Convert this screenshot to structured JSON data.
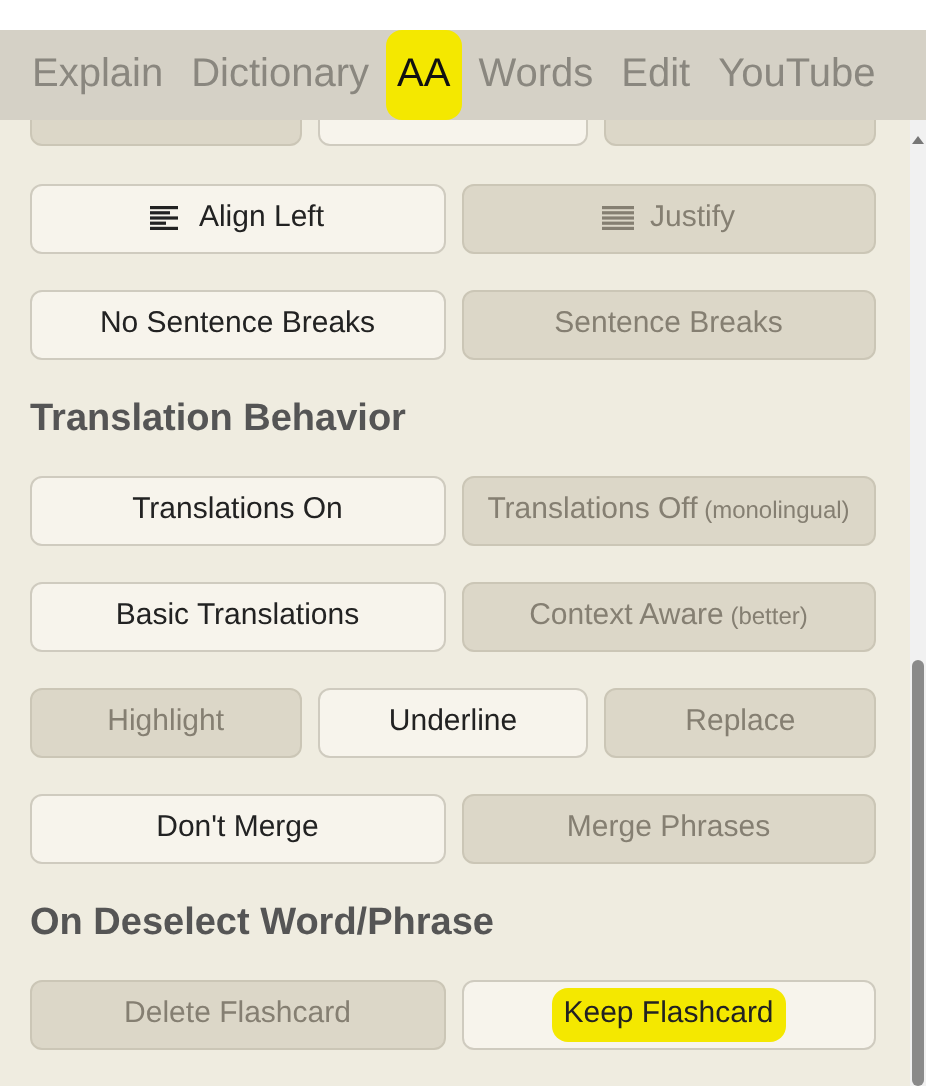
{
  "tabs": [
    {
      "label": "Explain",
      "selected": false,
      "marked": false
    },
    {
      "label": "Dictionary",
      "selected": false,
      "marked": false
    },
    {
      "label": "AA",
      "selected": true,
      "marked": true
    },
    {
      "label": "Words",
      "selected": false,
      "marked": false
    },
    {
      "label": "Edit",
      "selected": false,
      "marked": false
    },
    {
      "label": "YouTube",
      "selected": false,
      "marked": false
    }
  ],
  "sections": [
    {
      "rows": [
        {
          "options": [
            {
              "selected": false
            },
            {
              "selected": true
            },
            {
              "selected": false
            }
          ]
        },
        {
          "options": [
            {
              "label": "Align Left",
              "kind": "align-left",
              "selected": true,
              "marked": false
            },
            {
              "label": "Justify",
              "kind": "justify",
              "selected": false,
              "marked": false
            }
          ]
        },
        {
          "options": [
            {
              "label": "No Sentence Breaks",
              "selected": true,
              "marked": false
            },
            {
              "label": "Sentence Breaks",
              "selected": false,
              "marked": false
            }
          ]
        }
      ]
    },
    {
      "heading": "Translation Behavior",
      "rows": [
        {
          "options": [
            {
              "label": "Translations On",
              "selected": true,
              "marked": false
            },
            {
              "label": "Translations Off",
              "note": "(monolingual)",
              "selected": false,
              "marked": false
            }
          ]
        },
        {
          "options": [
            {
              "label": "Basic Translations",
              "selected": true,
              "marked": false
            },
            {
              "label": "Context Aware",
              "note": "(better)",
              "selected": false,
              "marked": false
            }
          ]
        },
        {
          "options": [
            {
              "label": "Highlight",
              "selected": false,
              "marked": false
            },
            {
              "label": "Underline",
              "selected": true,
              "marked": false
            },
            {
              "label": "Replace",
              "selected": false,
              "marked": false
            }
          ]
        },
        {
          "options": [
            {
              "label": "Don't Merge",
              "selected": true,
              "marked": false
            },
            {
              "label": "Merge Phrases",
              "selected": false,
              "marked": false
            }
          ]
        }
      ]
    },
    {
      "heading": "On Deselect Word/Phrase",
      "rows": [
        {
          "options": [
            {
              "label": "Delete Flashcard",
              "selected": false,
              "marked": false
            },
            {
              "label": "Keep Flashcard",
              "selected": true,
              "marked": true
            }
          ]
        }
      ]
    }
  ]
}
